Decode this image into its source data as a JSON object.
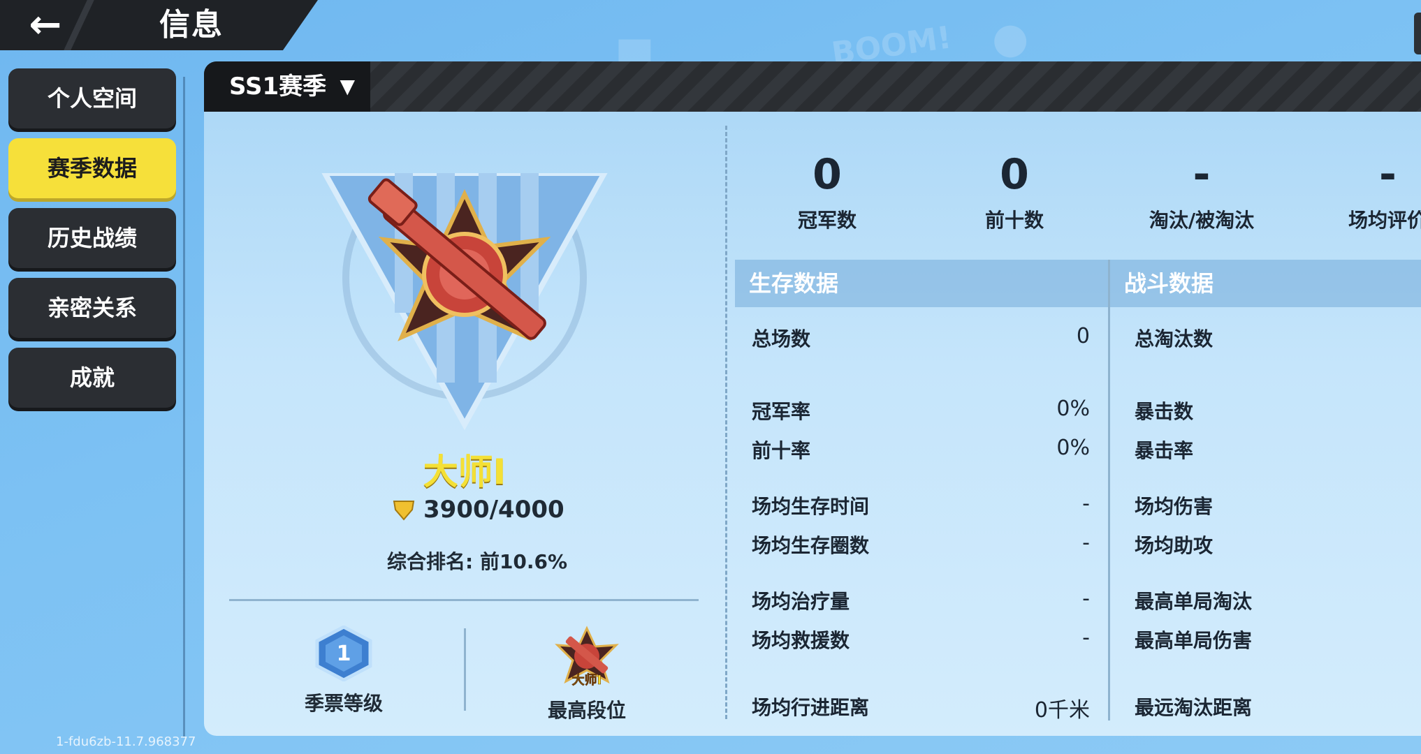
{
  "header": {
    "title": "信息",
    "back_icon": "arrow-left-icon"
  },
  "sidebar": {
    "items": [
      {
        "label": "个人空间",
        "active": false
      },
      {
        "label": "赛季数据",
        "active": true
      },
      {
        "label": "历史战绩",
        "active": false
      },
      {
        "label": "亲密关系",
        "active": false
      },
      {
        "label": "成就",
        "active": false
      }
    ]
  },
  "season": {
    "selected": "SS1赛季",
    "caret_icon": "caret-down-icon"
  },
  "rank": {
    "name": "大师I",
    "points": "3900/4000",
    "ranking_label": "综合排名: ",
    "ranking_value": "前10.6%"
  },
  "badges": {
    "pass_level": {
      "value": "1",
      "label": "季票等级"
    },
    "highest_tier": {
      "tag": "大师I",
      "label": "最高段位"
    }
  },
  "summary": [
    {
      "value": "0",
      "label": "冠军数"
    },
    {
      "value": "0",
      "label": "前十数"
    },
    {
      "value": "-",
      "label": "淘汰/被淘汰"
    },
    {
      "value": "-",
      "label": "场均评价"
    }
  ],
  "survival": {
    "title": "生存数据",
    "rows": [
      {
        "label": "总场数",
        "value": "0"
      },
      {
        "label": "冠军率",
        "value": "0%"
      },
      {
        "label": "前十率",
        "value": "0%"
      },
      {
        "label": "场均生存时间",
        "value": "-"
      },
      {
        "label": "场均生存圈数",
        "value": "-"
      },
      {
        "label": "场均治疗量",
        "value": "-"
      },
      {
        "label": "场均救援数",
        "value": "-"
      },
      {
        "label": "场均行进距离",
        "value": "0千米"
      }
    ]
  },
  "combat": {
    "title": "战斗数据",
    "rows": [
      {
        "label": "总淘汰数"
      },
      {
        "label": "暴击数"
      },
      {
        "label": "暴击率"
      },
      {
        "label": "场均伤害"
      },
      {
        "label": "场均助攻"
      },
      {
        "label": "最高单局淘汰"
      },
      {
        "label": "最高单局伤害"
      },
      {
        "label": "最远淘汰距离"
      }
    ]
  },
  "build": "1-fdu6zb-11.7.968377",
  "colors": {
    "accent": "#f6e03a",
    "dark": "#2b2e33",
    "rank_gold": "#f4e036"
  }
}
